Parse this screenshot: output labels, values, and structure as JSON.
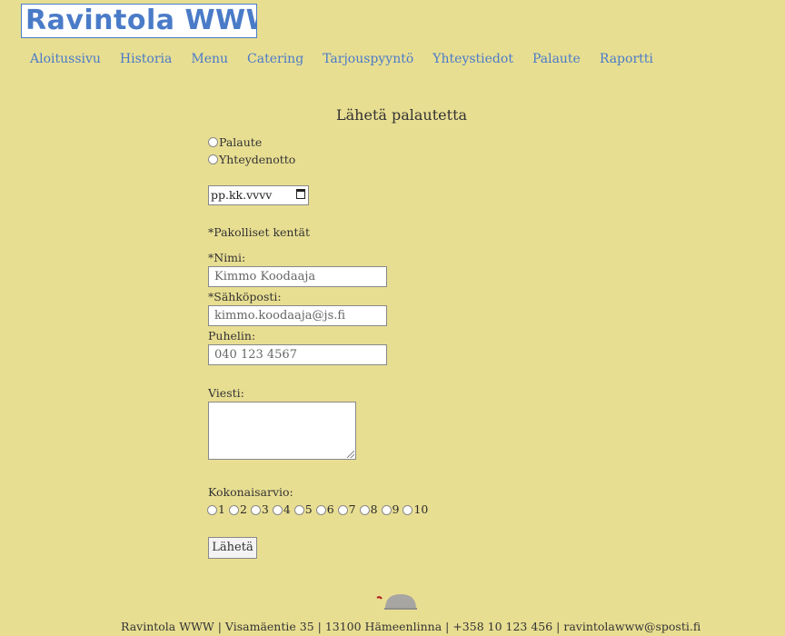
{
  "brand": {
    "logo_text": "Ravintola WWW"
  },
  "nav": {
    "items": [
      "Aloitussivu",
      "Historia",
      "Menu",
      "Catering",
      "Tarjouspyyntö",
      "Yhteystiedot",
      "Palaute",
      "Raportti"
    ]
  },
  "form": {
    "title": "Lähetä palautetta",
    "type_options": [
      "Palaute",
      "Yhteydenotto"
    ],
    "date_placeholder": "pp.kk.vvvv",
    "required_note": "*Pakolliset kentät",
    "name_label": "*Nimi:",
    "name_placeholder": "Kimmo Koodaaja",
    "email_label": "*Sähköposti:",
    "email_placeholder": "kimmo.koodaaja@js.fi",
    "phone_label": "Puhelin:",
    "phone_placeholder": "040 123 4567",
    "message_label": "Viesti:",
    "rating_label": "Kokonaisarvio:",
    "rating_options": [
      "1",
      "2",
      "3",
      "4",
      "5",
      "6",
      "7",
      "8",
      "9",
      "10"
    ],
    "submit_label": "Lähetä"
  },
  "footer": {
    "text": "Ravintola WWW | Visamäentie 35 | 13100 Hämeenlinna | +358 10 123 456 | ravintolawww@sposti.fi",
    "icon": "cloche-icon"
  },
  "colors": {
    "background": "#e8de92",
    "accent": "#4a7bc8"
  }
}
